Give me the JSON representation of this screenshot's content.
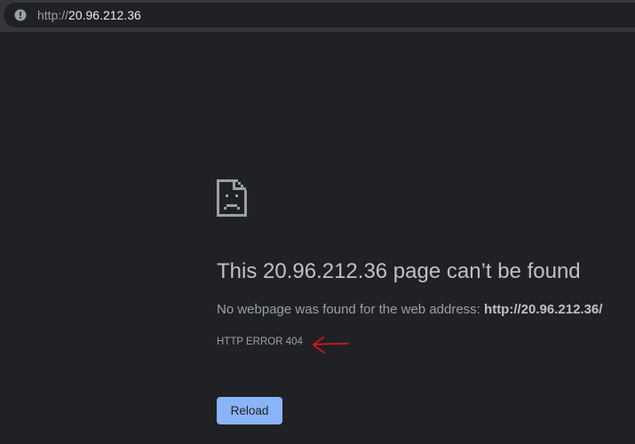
{
  "browser": {
    "address_bar": {
      "scheme": "http://",
      "host": "20.96.212.36",
      "icon": "info-icon"
    }
  },
  "error_page": {
    "icon": "sad-file-icon",
    "title": "This 20.96.212.36 page can’t be found",
    "message_prefix": "No webpage was found for the web address: ",
    "message_address": "http://20.96.212.36/",
    "error_code": "HTTP ERROR 404",
    "reload_label": "Reload",
    "annotation": "red-hand-drawn-arrow"
  },
  "colors": {
    "background": "#202124",
    "toolbar": "#35363a",
    "accent": "#8ab4f8",
    "annotation": "#e0151b"
  }
}
